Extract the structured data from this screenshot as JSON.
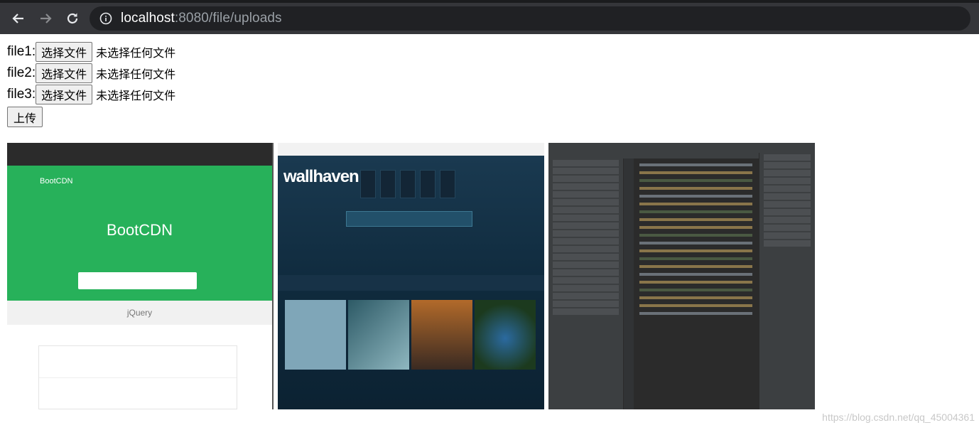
{
  "browser": {
    "back_icon": "arrow-left-icon",
    "forward_icon": "arrow-right-icon",
    "reload_icon": "reload-icon",
    "info_icon": "info-icon",
    "url_host": "localhost",
    "url_rest": ":8080/file/uploads"
  },
  "form": {
    "fields": [
      {
        "label": "file1:",
        "button": "选择文件",
        "status": "未选择任何文件"
      },
      {
        "label": "file2:",
        "button": "选择文件",
        "status": "未选择任何文件"
      },
      {
        "label": "file3:",
        "button": "选择文件",
        "status": "未选择任何文件"
      }
    ],
    "submit_label": "上传"
  },
  "images": [
    {
      "name": "bootcdn-screenshot",
      "brand": "BootCDN",
      "heading": "BootCDN",
      "logo_text": "jQuery"
    },
    {
      "name": "wallhaven-screenshot",
      "logo": "wallhaven"
    },
    {
      "name": "ide-screenshot"
    }
  ],
  "watermark": "https://blog.csdn.net/qq_45004361"
}
